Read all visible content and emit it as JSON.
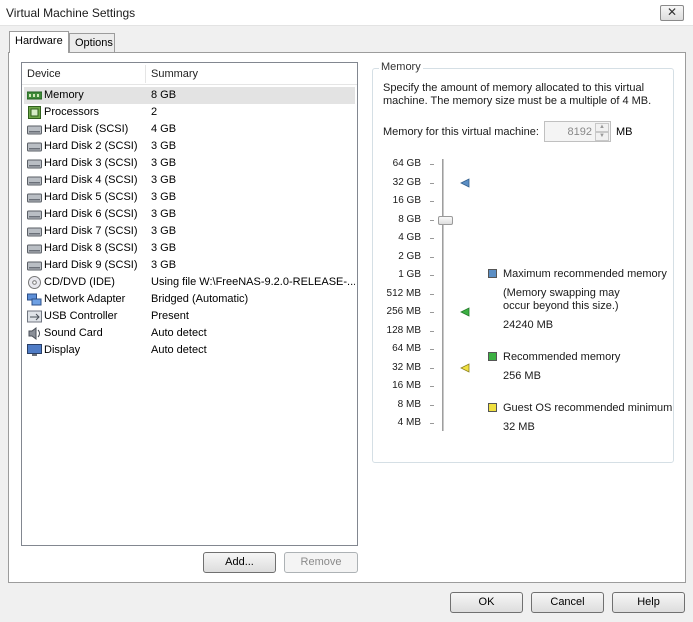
{
  "window": {
    "title": "Virtual Machine Settings",
    "close_glyph": "✕"
  },
  "tabs": [
    {
      "label": "Hardware",
      "active": true
    },
    {
      "label": "Options",
      "active": false
    }
  ],
  "device_list": {
    "columns": [
      "Device",
      "Summary"
    ],
    "rows": [
      {
        "device": "Memory",
        "summary": "8 GB",
        "icon": "memory-icon",
        "selected": true
      },
      {
        "device": "Processors",
        "summary": "2",
        "icon": "processor-icon"
      },
      {
        "device": "Hard Disk (SCSI)",
        "summary": "4 GB",
        "icon": "hard-disk-icon"
      },
      {
        "device": "Hard Disk 2 (SCSI)",
        "summary": "3 GB",
        "icon": "hard-disk-icon"
      },
      {
        "device": "Hard Disk 3 (SCSI)",
        "summary": "3 GB",
        "icon": "hard-disk-icon"
      },
      {
        "device": "Hard Disk 4 (SCSI)",
        "summary": "3 GB",
        "icon": "hard-disk-icon"
      },
      {
        "device": "Hard Disk 5 (SCSI)",
        "summary": "3 GB",
        "icon": "hard-disk-icon"
      },
      {
        "device": "Hard Disk 6 (SCSI)",
        "summary": "3 GB",
        "icon": "hard-disk-icon"
      },
      {
        "device": "Hard Disk 7 (SCSI)",
        "summary": "3 GB",
        "icon": "hard-disk-icon"
      },
      {
        "device": "Hard Disk 8 (SCSI)",
        "summary": "3 GB",
        "icon": "hard-disk-icon"
      },
      {
        "device": "Hard Disk 9 (SCSI)",
        "summary": "3 GB",
        "icon": "hard-disk-icon"
      },
      {
        "device": "CD/DVD (IDE)",
        "summary": "Using file W:\\FreeNAS-9.2.0-RELEASE-...",
        "icon": "cd-dvd-icon"
      },
      {
        "device": "Network Adapter",
        "summary": "Bridged (Automatic)",
        "icon": "network-adapter-icon"
      },
      {
        "device": "USB Controller",
        "summary": "Present",
        "icon": "usb-icon"
      },
      {
        "device": "Sound Card",
        "summary": "Auto detect",
        "icon": "sound-card-icon"
      },
      {
        "device": "Display",
        "summary": "Auto detect",
        "icon": "display-icon"
      }
    ],
    "add_label": "Add...",
    "remove_label": "Remove"
  },
  "memory": {
    "group_title": "Memory",
    "description": "Specify the amount of memory allocated to this virtual machine. The memory size must be a multiple of 4 MB.",
    "field_label": "Memory for this virtual machine:",
    "value": "8192",
    "unit": "MB",
    "scale": [
      "64 GB",
      "32 GB",
      "16 GB",
      "8 GB",
      "4 GB",
      "2 GB",
      "1 GB",
      "512 MB",
      "256 MB",
      "128 MB",
      "64 MB",
      "32 MB",
      "16 MB",
      "8 MB",
      "4 MB"
    ],
    "slider_level": "8 GB",
    "legend": {
      "max": {
        "label": "Maximum recommended memory",
        "note": "(Memory swapping may occur beyond this size.)",
        "value": "24240 MB",
        "color": "#5b8ec4",
        "marker_level": "32 GB"
      },
      "recommended": {
        "label": "Recommended memory",
        "value": "256 MB",
        "color": "#3cb043",
        "marker_level": "256 MB"
      },
      "guest_min": {
        "label": "Guest OS recommended minimum",
        "value": "32 MB",
        "color": "#f0e040",
        "marker_level": "32 MB"
      }
    }
  },
  "buttons": {
    "ok": "OK",
    "cancel": "Cancel",
    "help": "Help"
  }
}
